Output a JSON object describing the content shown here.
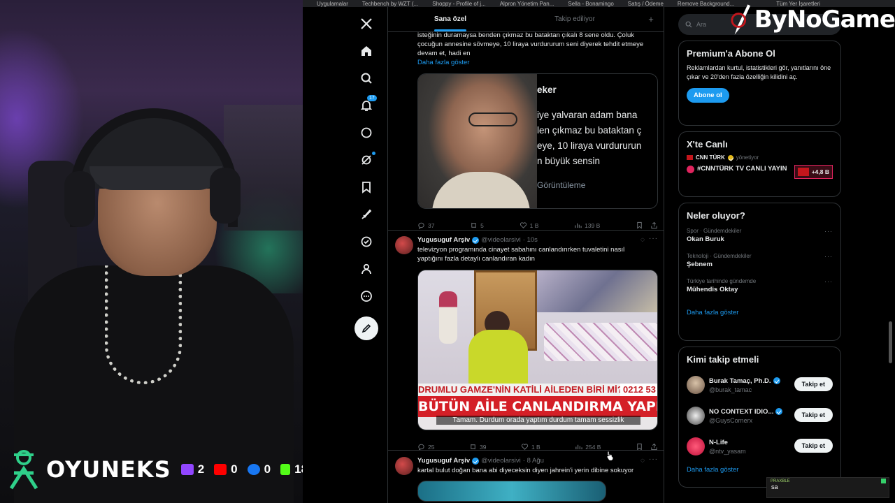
{
  "bookmarks": [
    "Uygulamalar",
    "Techbench by WZT (...",
    "Shoppy - Profile of j...",
    "Alpron Yönetim Pan...",
    "Sella - Bonamingo",
    "Satış / Ödeme",
    "Remove Background...",
    "Tüm Yer İşaretleri"
  ],
  "stream": {
    "brand": "OYUNEKS",
    "stats": [
      {
        "icon": "twitch-icon",
        "value": "2",
        "color": "#9146ff"
      },
      {
        "icon": "youtube-icon",
        "value": "0",
        "color": "#ff0000"
      },
      {
        "icon": "facebook-icon",
        "value": "0",
        "color": "#1877f2"
      },
      {
        "icon": "kick-icon",
        "value": "18",
        "color": "#53fc18"
      }
    ],
    "watermark": "ByNoGame",
    "chat": {
      "user": "PRAXBLE",
      "message": "sa"
    }
  },
  "tabs": {
    "for_you": "Sana özel",
    "following": "Takip ediliyor",
    "plus": "+"
  },
  "tweet1": {
    "text": "isteğinin duramaysa benden çıkmaz bu bataktan çıkalı 8 sene oldu. Çoluk çocuğun annesine sövmeye, 10 liraya vurdururum seni diyerek tehdit etmeye devam et, hadi en",
    "show_more": "Daha fazla göster",
    "media_lines": [
      "eker",
      "iye yalvaran adam bana",
      "len çıkmaz bu bataktan ç",
      "eye, 10 liraya vurdururun",
      "n büyük sensin",
      "Görüntüleme"
    ],
    "replies": "37",
    "reposts": "5",
    "likes": "1 B",
    "views": "139 B"
  },
  "tweet2": {
    "name": "Yugusuguf Arşiv",
    "handle": "@videolarsivi",
    "time": "· 10s",
    "text": "televizyon programında cinayet sabahını canlandırırken tuvaletini nasıl yaptığını fazla detaylı canlandıran kadın",
    "lower1": "DRUMLU GAMZE'NİN KATİLİ AİLEDEN BİRİ Mİ?",
    "phone": "0212 53",
    "lower2": "BÜTÜN AİLE CANLANDIRMA YAPIYOR",
    "subtitle": "Tamam. Durdum orada yaptım durdum tamam sessizlik",
    "replies": "25",
    "reposts": "39",
    "likes": "1 B",
    "views": "254 B"
  },
  "tweet3": {
    "name": "Yugusuguf Arşiv",
    "handle": "@videolarsivi",
    "time": "· 8 Ağu",
    "text": "kartal bulut doğan bana abi diyeceksin diyen jahrein'i yerin dibine sokuyor"
  },
  "nav": {
    "notification_count": "17"
  },
  "right": {
    "search_placeholder": "Ara",
    "premium": {
      "title": "Premium'a Abone Ol",
      "body": "Reklamlardan kurtul, istatistikleri gör, yanıtlarını öne çıkar ve 20'den fazla özelliğin kilidini aç.",
      "button": "Abone ol"
    },
    "live": {
      "title": "X'te Canlı",
      "host": "CNN TÜRK",
      "host_sub": "yönetiyor",
      "stream": "#CNNTÜRK TV CANLI YAYIN",
      "count": "+4,8 B"
    },
    "trends": {
      "title": "Neler oluyor?",
      "items": [
        {
          "category": "Spor · Gündemdekiler",
          "name": "Okan Buruk"
        },
        {
          "category": "Teknoloji · Gündemdekiler",
          "name": "Şebnem"
        },
        {
          "category": "Türkiye tarihinde gündemde",
          "name": "Mühendis Oktay"
        }
      ],
      "show_more": "Daha fazla göster"
    },
    "who_to_follow": {
      "title": "Kimi takip etmeli",
      "items": [
        {
          "name": "Burak Tamaç, Ph.D.",
          "handle": "@burak_tamac",
          "button": "Takip et"
        },
        {
          "name": "NO CONTEXT IDIO...",
          "handle": "@GuysCornerx",
          "button": "Takip et"
        },
        {
          "name": "N-Life",
          "handle": "@ntv_yasam",
          "button": "Takip et"
        }
      ],
      "show_more": "Daha fazla göster"
    }
  }
}
